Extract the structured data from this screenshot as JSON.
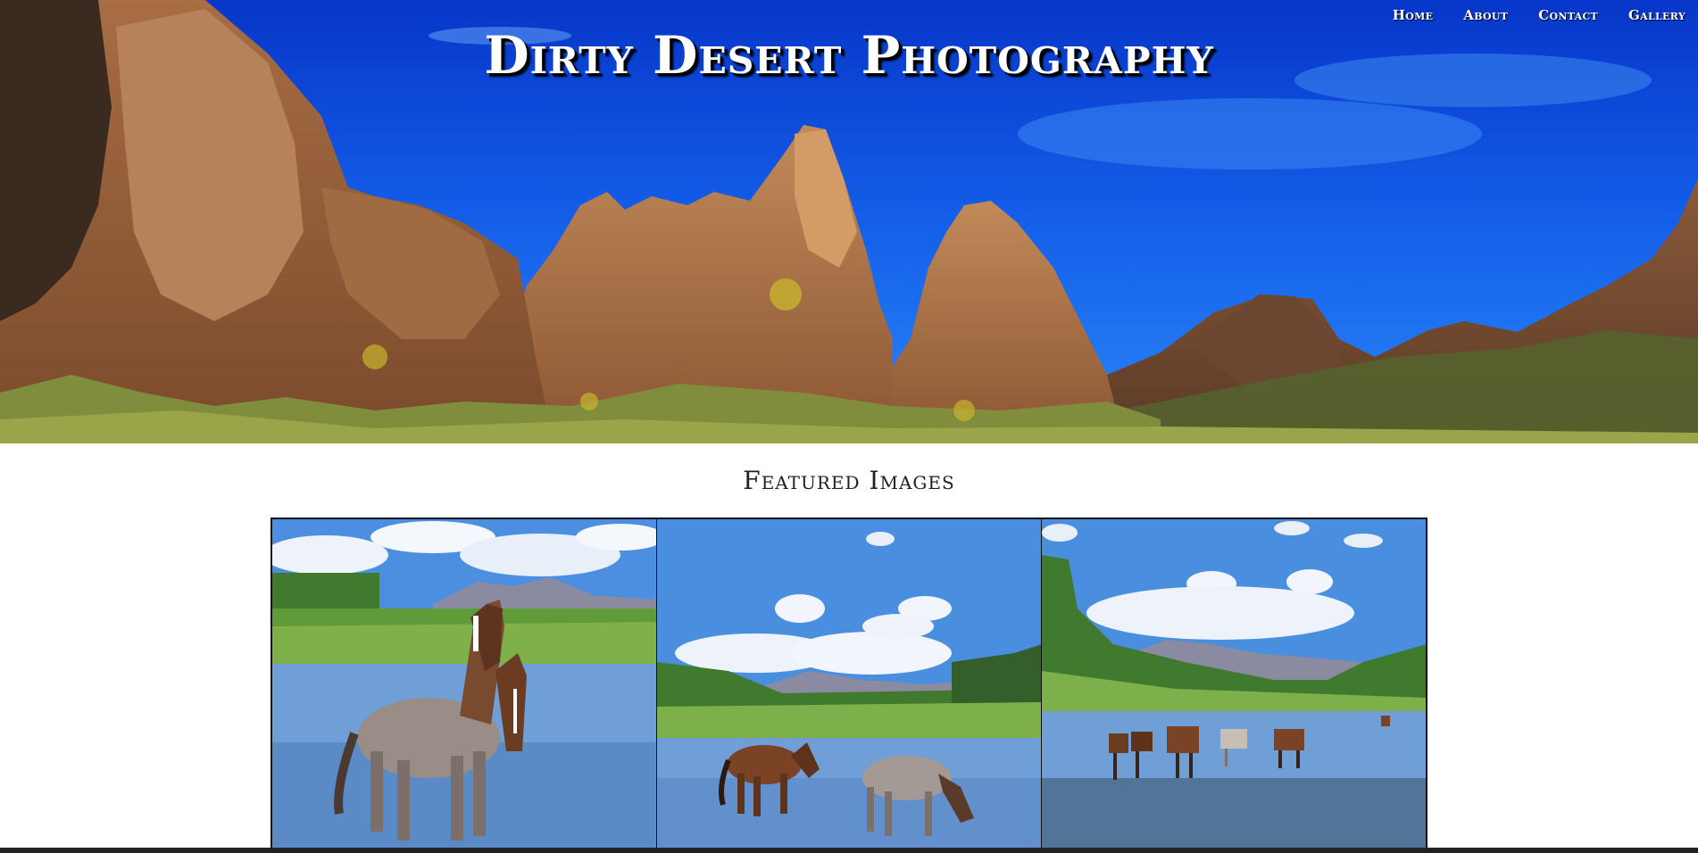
{
  "site": {
    "title": "Dirty Desert Photography"
  },
  "nav": {
    "items": [
      {
        "label": "Home"
      },
      {
        "label": "About"
      },
      {
        "label": "Contact"
      },
      {
        "label": "Gallery"
      }
    ]
  },
  "featured": {
    "heading": "Featured Images",
    "images": [
      {
        "subject": "two horses standing in river"
      },
      {
        "subject": "two horses grazing in shallow river"
      },
      {
        "subject": "herd of horses crossing river"
      }
    ]
  },
  "colors": {
    "sky": "#1457e8",
    "rock": "#b07a4e",
    "title_text": "#ffffff",
    "heading_text": "#222222"
  }
}
